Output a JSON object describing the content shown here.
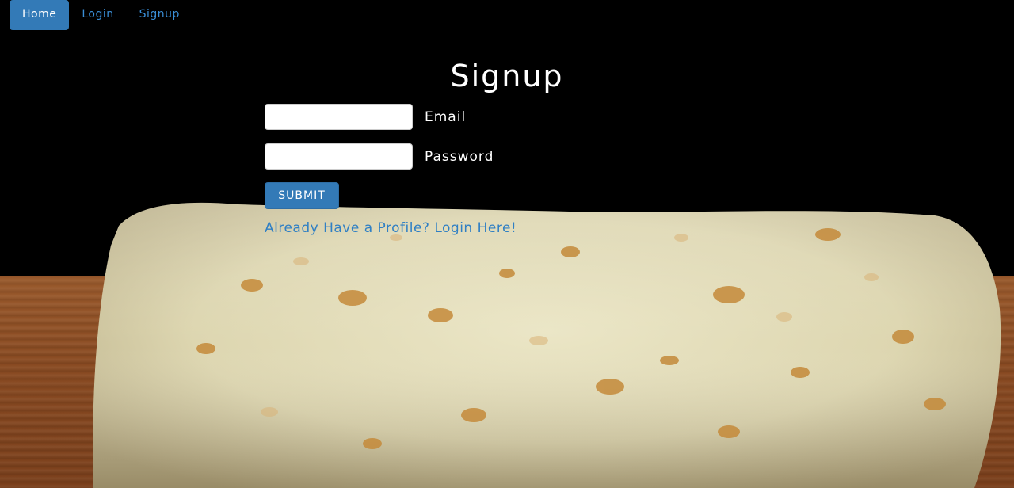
{
  "nav": {
    "items": [
      {
        "label": "Home",
        "active": true
      },
      {
        "label": "Login",
        "active": false
      },
      {
        "label": "Signup",
        "active": false
      }
    ]
  },
  "form": {
    "title": "Signup",
    "email_label": "Email",
    "email_value": "",
    "password_label": "Password",
    "password_value": "",
    "submit_label": "SUBMIT",
    "login_link": "Already Have a Profile? Login Here!"
  },
  "colors": {
    "accent": "#337ab7",
    "link": "#2f7fc4",
    "background": "#000000"
  },
  "background_image": "burrito-on-wooden-table"
}
